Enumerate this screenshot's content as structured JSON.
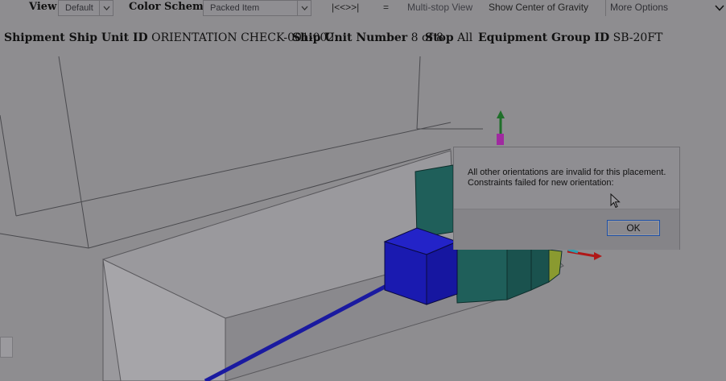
{
  "toolbar": {
    "view_label": "View",
    "view_value": "Default",
    "color_scheme_label": "Color Scheme",
    "color_scheme_value": "Packed Item",
    "nav_controls": "|<<>>|",
    "equals": "=",
    "multi_stop_view": "Multi-stop View",
    "show_center_of_gravity": "Show Center of Gravity",
    "more_options": "More Options"
  },
  "info": {
    "ship_unit_id_label": "Shipment Ship Unit ID",
    "ship_unit_id_value": "ORIENTATION CHECK-001-002",
    "ship_unit_number_label": "Ship Unit Number",
    "ship_unit_number_value": "8 of 8",
    "stop_label": "Stop",
    "stop_value": "All",
    "equipment_group_label": "Equipment Group ID",
    "equipment_group_value": "SB-20FT"
  },
  "dialog": {
    "line1": "All other orientations are invalid for this placement.",
    "line2": "Constraints failed for new orientation:",
    "ok_label": "OK"
  },
  "colors": {
    "background": "#8e8d90",
    "blue_box": "#1a1ab0",
    "teal_box": "#1f5f5a",
    "track_line": "#1a1aa0",
    "axis_green": "#1f6f2a",
    "axis_red": "#b01818",
    "focus_border": "#1e50a6"
  }
}
